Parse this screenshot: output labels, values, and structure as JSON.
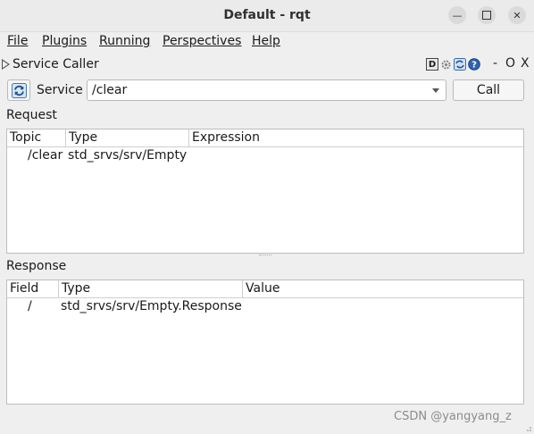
{
  "window": {
    "title": "Default - rqt",
    "minimize_icon": "minimize-icon",
    "maximize_icon": "maximize-icon",
    "close_icon": "close-icon"
  },
  "menu": {
    "file": "File",
    "plugins": "Plugins",
    "running": "Running",
    "perspectives": "Perspectives",
    "help": "Help"
  },
  "dock": {
    "title": "Service Caller",
    "d_label": "D",
    "minimize_sym": "-",
    "float_sym": "O",
    "close_sym": "X"
  },
  "toolbar": {
    "service_label": "Service",
    "service_value": "/clear",
    "call_label": "Call"
  },
  "request": {
    "label": "Request",
    "columns": [
      "Topic",
      "Type",
      "Expression"
    ],
    "rows": [
      {
        "topic": "/clear",
        "type": "std_srvs/srv/Empty",
        "expression": ""
      }
    ]
  },
  "response": {
    "label": "Response",
    "columns": [
      "Field",
      "Type",
      "Value"
    ],
    "rows": [
      {
        "field": "/",
        "type": "std_srvs/srv/Empty.Response",
        "value": ""
      }
    ]
  },
  "watermark": "CSDN @yangyang_z"
}
